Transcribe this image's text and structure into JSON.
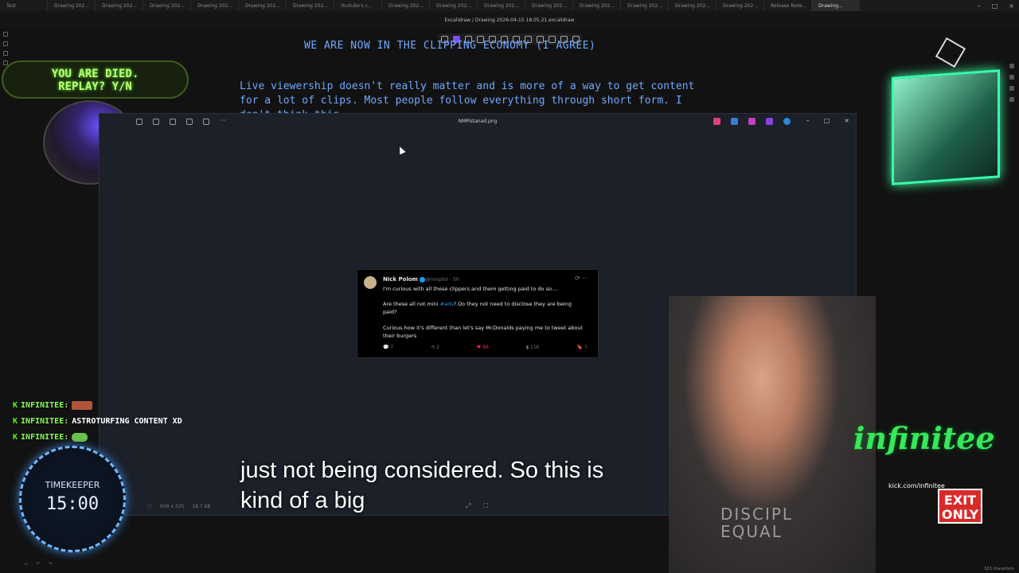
{
  "browser": {
    "tabs": [
      "Test",
      "Drawing 202...",
      "Drawing 202...",
      "Drawing 202...",
      "Drawing 202...",
      "Drawing 202...",
      "Drawing 202...",
      "Youtube's c...",
      "Drawing 202...",
      "Drawing 202...",
      "Drawing 202...",
      "Drawing 202...",
      "Drawing 202...",
      "Drawing 202...",
      "Drawing 202...",
      "Drawing 202...",
      "Release Note...",
      "Drawing..."
    ],
    "breadcrumb": "Excalidraw  /  Drawing 2026-04-15 18.05.21.excalidraw"
  },
  "canvas": {
    "heading": "WE ARE NOW IN THE CLIPPING ECONOMY (I AGREE)",
    "paragraph": "Live viewership doesn't really matter and is more of a way to get content for a lot of clips. Most people follow everything through short form. I don't think this"
  },
  "overlay": {
    "died_text": "YOU ARE DIED.\nREPLAY? Y/N",
    "caption_line1": "just not being considered. So this is",
    "caption_line2": "kind of a big",
    "timer_label": "TIMEKEEPER",
    "timer_value": "15:00",
    "brand": "infinitee",
    "brand_sub": "kick.com/infinitee",
    "exit_label": "EXIT\nONLY",
    "shirt_text": "DISCIPL\nEQUAL"
  },
  "chat": [
    {
      "user": "INFINITEE:",
      "message": ""
    },
    {
      "user": "INFINITEE:",
      "message": "ASTROTURFING CONTENT XD"
    },
    {
      "user": "INFINITEE:",
      "message": ""
    }
  ],
  "viewer": {
    "title": "NMPIstanad.png",
    "footer": [
      "609 x 225",
      "18.7 KB"
    ]
  },
  "tweet": {
    "name": "Nick Polom",
    "handle": "@nmplol · 5h",
    "line1": "I'm curious with all these clippers and them getting paid to do so....",
    "line2a": "Are these all not mini ",
    "line2_hashtag": "#ads",
    "line2b": "? Do they not need to disclose they are being paid?",
    "line3": "Curious how it's different than let's say McDonalds paying me to tweet about their burgers",
    "replies": "7",
    "reposts": "2",
    "likes": "66",
    "views": "11K"
  },
  "status": {
    "right": "523 characters"
  },
  "colors": {
    "accent": "#7c4dff",
    "handwriting": "#6ea8ff",
    "chat_name": "#8cff5a",
    "brand": "#37e85a",
    "exit": "#d92a2a"
  }
}
